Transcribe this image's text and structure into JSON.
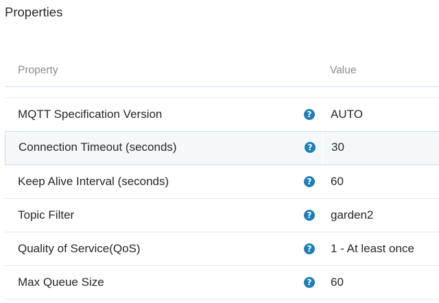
{
  "panel": {
    "title": "Properties"
  },
  "table": {
    "headers": {
      "property": "Property",
      "value": "Value"
    },
    "help_icon_glyph": "?",
    "rows": [
      {
        "name": "MQTT Specification Version",
        "value": "AUTO",
        "selected": false
      },
      {
        "name": "Connection Timeout (seconds)",
        "value": "30",
        "selected": true
      },
      {
        "name": "Keep Alive Interval (seconds)",
        "value": "60",
        "selected": false
      },
      {
        "name": "Topic Filter",
        "value": "garden2",
        "selected": false
      },
      {
        "name": "Quality of Service(QoS)",
        "value": "1 - At least once",
        "selected": false
      },
      {
        "name": "Max Queue Size",
        "value": "60",
        "selected": false
      }
    ]
  },
  "colors": {
    "help_icon": "#1e7fb8",
    "header_text": "#8a8a8a",
    "selected_row_bg": "#f4f8fb"
  }
}
